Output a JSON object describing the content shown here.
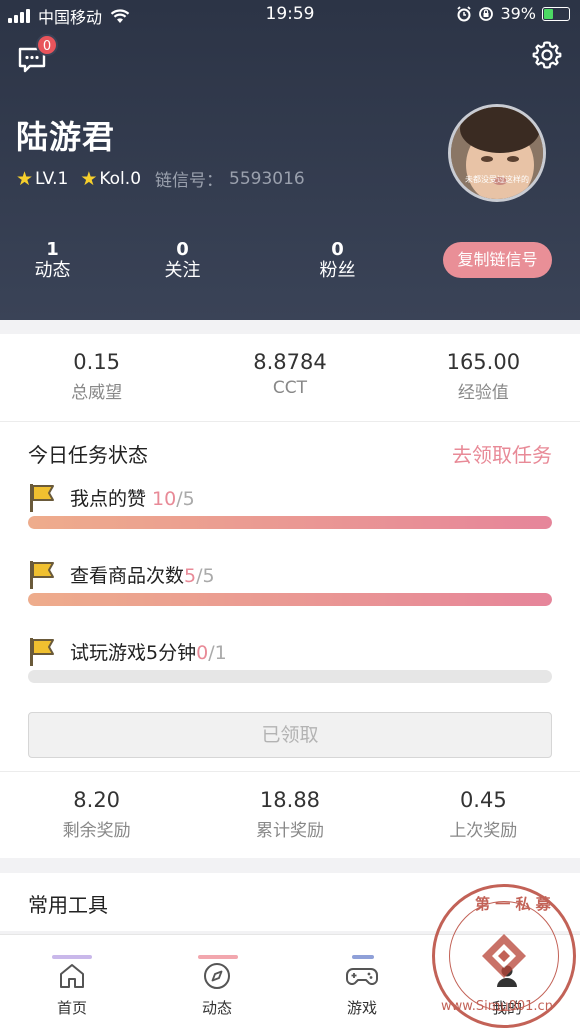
{
  "status_bar": {
    "carrier": "中国移动",
    "time": "19:59",
    "battery": "39%"
  },
  "header": {
    "message_badge": "0",
    "username": "陆游君",
    "level": "LV.1",
    "kol": "Kol.0",
    "chain_label": "链信号：",
    "chain_id": "5593016",
    "avatar_caption": "未都没受过这样的",
    "stats": [
      {
        "value": "1",
        "label": "动态"
      },
      {
        "value": "0",
        "label": "关注"
      },
      {
        "value": "0",
        "label": "粉丝"
      }
    ],
    "copy_button": "复制链信号"
  },
  "metrics": [
    {
      "value": "0.15",
      "label": "总威望"
    },
    {
      "value": "8.8784",
      "label": "CCT"
    },
    {
      "value": "165.00",
      "label": "经验值"
    }
  ],
  "tasks": {
    "title": "今日任务状态",
    "link": "去领取任务",
    "items": [
      {
        "name": "我点的赞 ",
        "current": "10",
        "total": "/5",
        "progress": 1.0
      },
      {
        "name": "查看商品次数",
        "current": "5",
        "total": "/5",
        "progress": 1.0
      },
      {
        "name": "试玩游戏5分钟",
        "current": "0",
        "total": "/1",
        "progress": 0.0
      }
    ],
    "claim_button": "已领取"
  },
  "rewards": [
    {
      "value": "8.20",
      "label": "剩余奖励"
    },
    {
      "value": "18.88",
      "label": "累计奖励"
    },
    {
      "value": "0.45",
      "label": "上次奖励"
    }
  ],
  "tools": {
    "title": "常用工具"
  },
  "tabbar": [
    {
      "label": "首页",
      "icon": "home-icon"
    },
    {
      "label": "动态",
      "icon": "compass-icon"
    },
    {
      "label": "游戏",
      "icon": "gamepad-icon"
    },
    {
      "label": "我的",
      "icon": "user-icon"
    }
  ],
  "watermark": {
    "top_text": "第 一 私 募",
    "bottom_text": "www.Simu001.cn"
  },
  "colors": {
    "accent": "#e88a97",
    "header_bg": "#2c3446",
    "star": "#f7d02c"
  }
}
